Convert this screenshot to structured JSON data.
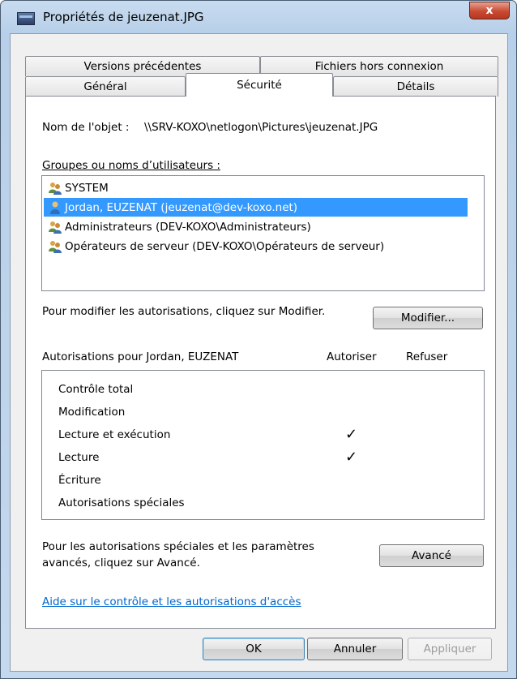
{
  "window": {
    "title": "Propriétés de jeuzenat.JPG",
    "close_label": "x"
  },
  "tabs": {
    "row1": [
      "Versions précédentes",
      "Fichiers hors connexion"
    ],
    "row2": [
      "Général",
      "Sécurité",
      "Détails"
    ],
    "active": "Sécurité"
  },
  "security": {
    "object_label": "Nom de l'objet :",
    "object_path": "\\\\SRV-KOXO\\netlogon\\Pictures\\jeuzenat.JPG",
    "groups_label": "Groupes ou noms d’utilisateurs :",
    "groups": [
      {
        "label": "SYSTEM",
        "icon": "users-group-icon",
        "selected": false
      },
      {
        "label": "Jordan, EUZENAT (jeuzenat@dev-koxo.net)",
        "icon": "user-icon",
        "selected": true
      },
      {
        "label": "Administrateurs (DEV-KOXO\\Administrateurs)",
        "icon": "users-group-icon",
        "selected": false
      },
      {
        "label": "Opérateurs de serveur (DEV-KOXO\\Opérateurs de serveur)",
        "icon": "users-group-icon",
        "selected": false
      }
    ],
    "modify_hint": "Pour modifier les autorisations, cliquez sur Modifier.",
    "modify_button": "Modifier...",
    "permissions_label": "Autorisations pour Jordan, EUZENAT",
    "allow_header": "Autoriser",
    "deny_header": "Refuser",
    "permissions": [
      {
        "name": "Contrôle total",
        "allow": false,
        "deny": false
      },
      {
        "name": "Modification",
        "allow": false,
        "deny": false
      },
      {
        "name": "Lecture et exécution",
        "allow": true,
        "deny": false
      },
      {
        "name": "Lecture",
        "allow": true,
        "deny": false
      },
      {
        "name": "Écriture",
        "allow": false,
        "deny": false
      },
      {
        "name": "Autorisations spéciales",
        "allow": false,
        "deny": false
      }
    ],
    "check_glyph": "✓",
    "advanced_hint_line1": "Pour les autorisations spéciales et les paramètres",
    "advanced_hint_line2": "avancés, cliquez sur Avancé.",
    "advanced_button": "Avancé",
    "help_link": "Aide sur le contrôle et les autorisations d'accès"
  },
  "footer": {
    "ok": "OK",
    "cancel": "Annuler",
    "apply": "Appliquer"
  },
  "colors": {
    "selection": "#3399ff",
    "link": "#0066cc",
    "close_button": "#c84a33"
  }
}
